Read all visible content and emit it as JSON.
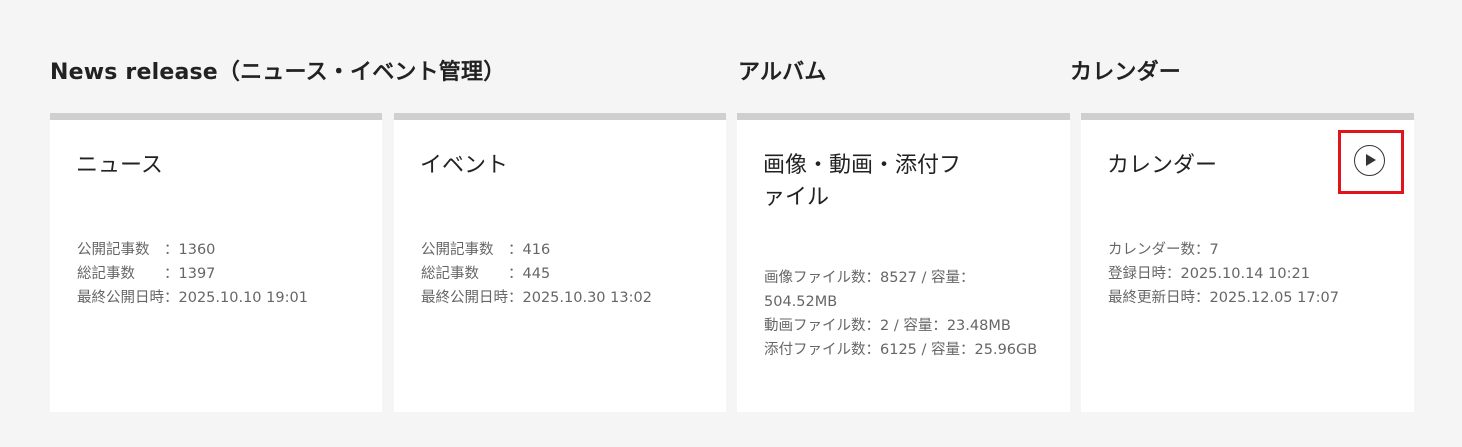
{
  "sections": {
    "news_title": "News release（ニュース・イベント管理）",
    "album_title": "アルバム",
    "calendar_title": "カレンダー"
  },
  "cards": {
    "news": {
      "title": "ニュース",
      "rows": [
        {
          "label": "公開記事数",
          "sep": "　：",
          "value": "1360"
        },
        {
          "label": "総記事数",
          "sep": "　　：",
          "value": "1397"
        },
        {
          "label": "最終公開日時",
          "sep": "：",
          "value": "2025.10.10 19:01"
        }
      ]
    },
    "event": {
      "title": "イベント",
      "rows": [
        {
          "label": "公開記事数",
          "sep": "　：",
          "value": "416"
        },
        {
          "label": "総記事数",
          "sep": "　　：",
          "value": "445"
        },
        {
          "label": "最終公開日時",
          "sep": "：",
          "value": "2025.10.30 13:02"
        }
      ]
    },
    "album": {
      "title": "画像・動画・添付ファイル",
      "rows": [
        "画像ファイル数：8527 / 容量：504.52MB",
        "動画ファイル数：2 / 容量：23.48MB",
        "添付ファイル数：6125 / 容量：25.96GB"
      ]
    },
    "calendar": {
      "title": "カレンダー",
      "rows": [
        "カレンダー数：7",
        "登録日時：2025.10.14 10:21",
        "最終更新日時：2025.12.05 17:07"
      ]
    }
  },
  "icons": {
    "play": "play-circle-icon",
    "highlight_color": "#e0141b"
  }
}
